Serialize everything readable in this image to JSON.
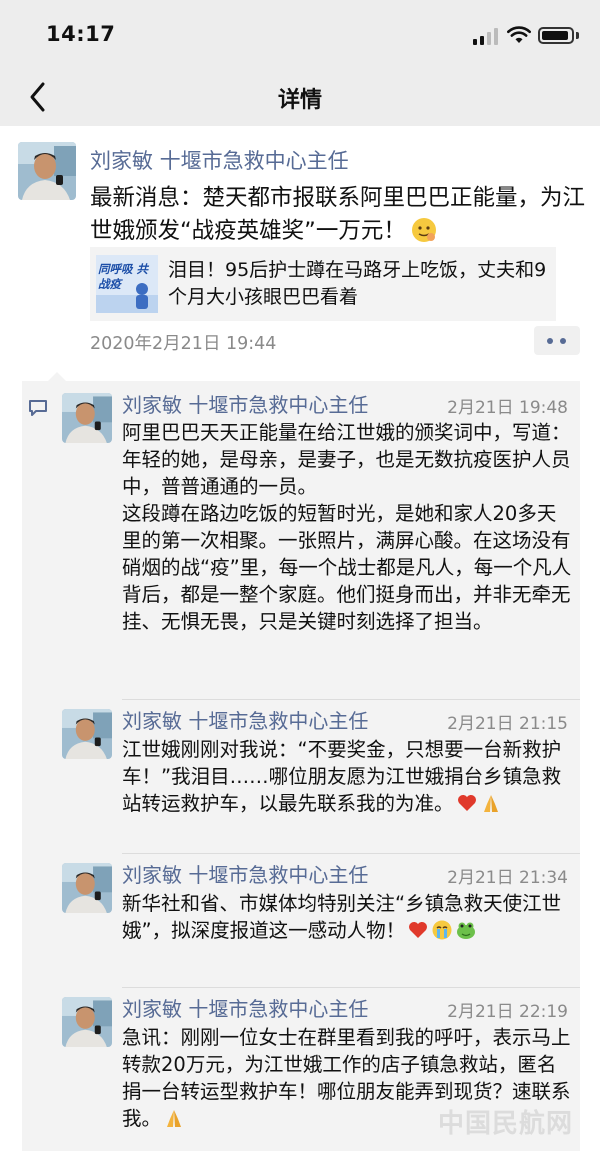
{
  "status_bar": {
    "time": "14:17"
  },
  "nav": {
    "title": "详情"
  },
  "post": {
    "author": "刘家敏 十堰市急救中心主任",
    "text": "最新消息：楚天都市报联系阿里巴巴正能量，为江世娥颁发“战疫英雄奖”一万元！",
    "link": {
      "thumb_text": "同呼吸 共战疫",
      "title": "泪目！95后护士蹲在马路牙上吃饭，丈夫和9个月大小孩眼巴巴看着"
    },
    "time": "2020年2月21日 19:44"
  },
  "comments": [
    {
      "author": "刘家敏 十堰市急救中心主任",
      "time": "2月21日 19:48",
      "text": "阿里巴巴天天正能量在给江世娥的颁奖词中，写道：\n年轻的她，是母亲，是妻子，也是无数抗疫医护人员中，普普通通的一员。\n这段蹲在路边吃饭的短暂时光，是她和家人20多天里的第一次相聚。一张照片，满屏心酸。在这场没有硝烟的战“疫”里，每一个战士都是凡人，每一个凡人背后，都是一整个家庭。他们挺身而出，并非无牵无挂、无惧无畏，只是关键时刻选择了担当。"
    },
    {
      "author": "刘家敏 十堰市急救中心主任",
      "time": "2月21日 21:15",
      "text": "江世娥刚刚对我说：“不要奖金，只想要一台新救护车！”我泪目……哪位朋友愿为江世娥捐台乡镇急救站转运救护车，以最先联系我的为准。"
    },
    {
      "author": "刘家敏 十堰市急救中心主任",
      "time": "2月21日 21:34",
      "text": "新华社和省、市媒体均特别关注“乡镇急救天使江世娥”，拟深度报道这一感动人物！"
    },
    {
      "author": "刘家敏 十堰市急救中心主任",
      "time": "2月21日 22:19",
      "text": "急讯：刚刚一位女士在群里看到我的呼吁，表示马上转款20万元，为江世娥工作的店子镇急救站，匿名捐一台转运型救护车！哪位朋友能弄到现货？速联系我。"
    }
  ],
  "watermark": "中国民航网",
  "colors": {
    "name_blue": "#576b95",
    "bar_gray": "#ededed",
    "comment_bg": "#f3f3f3"
  },
  "icons": [
    "back-icon",
    "signal-icon",
    "wifi-icon",
    "battery-icon",
    "comment-icon",
    "more-icon",
    "heart-icon",
    "pray-icon",
    "emoji-icon"
  ]
}
